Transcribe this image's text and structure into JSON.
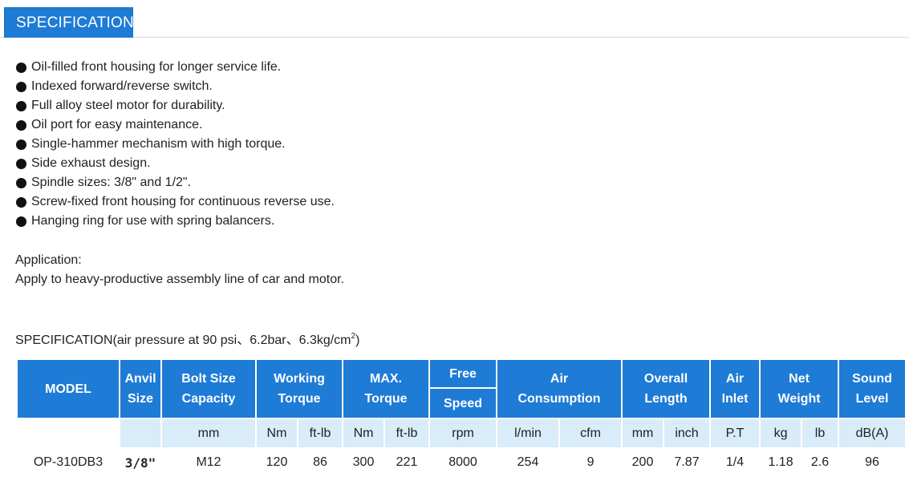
{
  "tab": {
    "label": "SPECIFICATION"
  },
  "features": [
    "Oil-filled front housing for longer service life.",
    "Indexed forward/reverse switch.",
    "Full alloy steel motor for durability.",
    "Oil port for easy maintenance.",
    "Single-hammer mechanism with high torque.",
    "Side exhaust design.",
    "Spindle sizes: 3/8\" and 1/2\".",
    "Screw-fixed front housing for continuous reverse use.",
    "Hanging ring for use with spring balancers."
  ],
  "application": {
    "heading": "Application:",
    "text": "Apply to heavy-productive assembly line of car and motor."
  },
  "spec_title": {
    "text": "SPECIFICATION(air pressure at 90 psi、6.2bar、6.3kg/cm",
    "sup": "2",
    "close": ")"
  },
  "table": {
    "headers": {
      "model": "MODEL",
      "anvil_1": "Anvil",
      "anvil_2": "Size",
      "bolt_1": "Bolt Size",
      "bolt_2": "Capacity",
      "working_1": "Working",
      "working_2": "Torque",
      "max_1": "MAX.",
      "max_2": "Torque",
      "free_1": "Free",
      "free_2": "Speed",
      "air_1": "Air",
      "air_2": "Consumption",
      "overall_1": "Overall",
      "overall_2": "Length",
      "inlet_1": "Air",
      "inlet_2": "Inlet",
      "net_1": "Net",
      "net_2": "Weight",
      "sound_1": "Sound",
      "sound_2": "Level"
    },
    "units": {
      "bolt": "mm",
      "working_nm": "Nm",
      "working_ftlb": "ft-lb",
      "max_nm": "Nm",
      "max_ftlb": "ft-lb",
      "speed": "rpm",
      "air_lmin": "l/min",
      "air_cfm": "cfm",
      "length_mm": "mm",
      "length_inch": "inch",
      "inlet": "P.T",
      "weight_kg": "kg",
      "weight_lb": "lb",
      "sound": "dB(A)"
    },
    "row": {
      "model": "OP-310DB3",
      "anvil": "3/8\"",
      "bolt": "M12",
      "working_nm": "120",
      "working_ftlb": "86",
      "max_nm": "300",
      "max_ftlb": "221",
      "speed": "8000",
      "air_lmin": "254",
      "air_cfm": "9",
      "length_mm": "200",
      "length_inch": "7.87",
      "inlet": "1/4",
      "weight_kg": "1.18",
      "weight_lb": "2.6",
      "sound": "96"
    }
  },
  "colors": {
    "accent": "#1e7bd6",
    "unit_row": "#d8ecf9",
    "anvil_value": "#e0121b"
  }
}
